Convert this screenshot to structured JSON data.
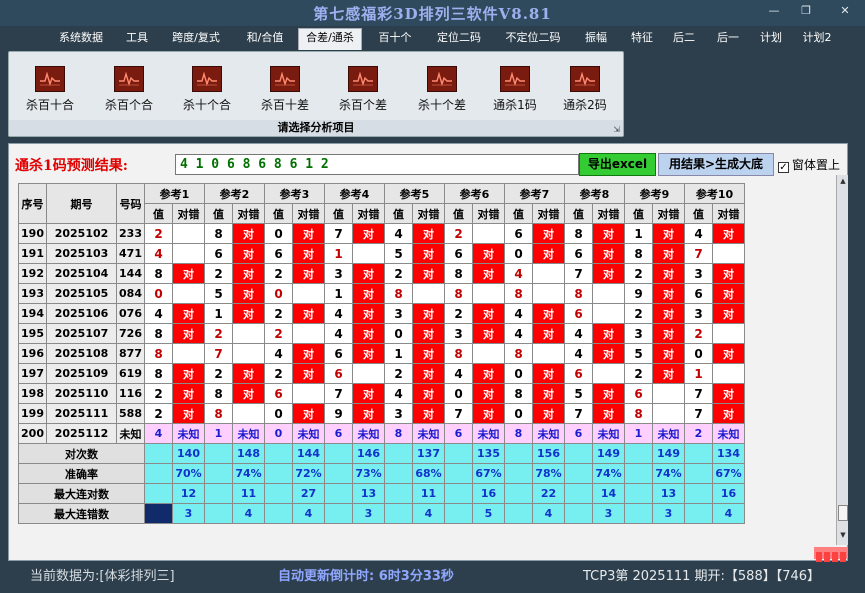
{
  "app": {
    "title": "第七感福彩3D排列三软件V8.81"
  },
  "window": {
    "minimize": "—",
    "maximize": "❐",
    "close": "✕"
  },
  "menu": [
    "系统数据",
    "工具",
    "跨度/复式",
    "和/合值",
    "合差/通杀",
    "百十个",
    "定位二码",
    "不定位二码",
    "振幅",
    "特征",
    "后二",
    "后一",
    "计划",
    "计划2"
  ],
  "menu_active": 4,
  "ribbon": {
    "buttons": [
      "杀百十合",
      "杀百个合",
      "杀十个合",
      "杀百十差",
      "杀百个差",
      "杀十个差",
      "通杀1码",
      "通杀2码"
    ],
    "caption": "请选择分析项目",
    "corner": "⇲"
  },
  "prediction": {
    "label": "通杀1码预测结果:",
    "value": "4 1 0 6 8 6 8 6 1 2",
    "export_button": "导出excel",
    "generate_button": "用结果>生成大底",
    "topmost_label": "窗体置上",
    "topmost_checked": "✓"
  },
  "table": {
    "headers": {
      "seq": "序号",
      "issue": "期号",
      "number": "号码",
      "value": "值",
      "result": "对错"
    },
    "refs": [
      "参考1",
      "参考2",
      "参考3",
      "参考4",
      "参考5",
      "参考6",
      "参考7",
      "参考8",
      "参考9",
      "参考10"
    ],
    "rows": [
      {
        "seq": "190",
        "issue": "2025102",
        "number": "233",
        "cells": [
          [
            "2",
            "",
            1
          ],
          [
            "8",
            "对",
            0
          ],
          [
            "0",
            "对",
            0
          ],
          [
            "7",
            "对",
            0
          ],
          [
            "4",
            "对",
            0
          ],
          [
            "2",
            "",
            1
          ],
          [
            "6",
            "对",
            0
          ],
          [
            "8",
            "对",
            0
          ],
          [
            "1",
            "对",
            0
          ],
          [
            "4",
            "对",
            0
          ]
        ]
      },
      {
        "seq": "191",
        "issue": "2025103",
        "number": "471",
        "cells": [
          [
            "4",
            "",
            1
          ],
          [
            "6",
            "对",
            0
          ],
          [
            "6",
            "对",
            0
          ],
          [
            "1",
            "",
            1
          ],
          [
            "5",
            "对",
            0
          ],
          [
            "6",
            "对",
            0
          ],
          [
            "0",
            "对",
            0
          ],
          [
            "6",
            "对",
            0
          ],
          [
            "8",
            "对",
            0
          ],
          [
            "7",
            "",
            1
          ]
        ]
      },
      {
        "seq": "192",
        "issue": "2025104",
        "number": "144",
        "cells": [
          [
            "8",
            "对",
            0
          ],
          [
            "2",
            "对",
            0
          ],
          [
            "2",
            "对",
            0
          ],
          [
            "3",
            "对",
            0
          ],
          [
            "2",
            "对",
            0
          ],
          [
            "8",
            "对",
            0
          ],
          [
            "4",
            "",
            1
          ],
          [
            "7",
            "对",
            0
          ],
          [
            "2",
            "对",
            0
          ],
          [
            "3",
            "对",
            0
          ]
        ]
      },
      {
        "seq": "193",
        "issue": "2025105",
        "number": "084",
        "cells": [
          [
            "0",
            "",
            1
          ],
          [
            "5",
            "对",
            0
          ],
          [
            "0",
            "",
            1
          ],
          [
            "1",
            "对",
            0
          ],
          [
            "8",
            "",
            1
          ],
          [
            "8",
            "",
            1
          ],
          [
            "8",
            "",
            1
          ],
          [
            "8",
            "",
            1
          ],
          [
            "9",
            "对",
            0
          ],
          [
            "6",
            "对",
            0
          ]
        ]
      },
      {
        "seq": "194",
        "issue": "2025106",
        "number": "076",
        "cells": [
          [
            "4",
            "对",
            0
          ],
          [
            "1",
            "对",
            0
          ],
          [
            "2",
            "对",
            0
          ],
          [
            "4",
            "对",
            0
          ],
          [
            "3",
            "对",
            0
          ],
          [
            "2",
            "对",
            0
          ],
          [
            "4",
            "对",
            0
          ],
          [
            "6",
            "",
            1
          ],
          [
            "2",
            "对",
            0
          ],
          [
            "3",
            "对",
            0
          ]
        ]
      },
      {
        "seq": "195",
        "issue": "2025107",
        "number": "726",
        "cells": [
          [
            "8",
            "对",
            0
          ],
          [
            "2",
            "",
            1
          ],
          [
            "2",
            "",
            1
          ],
          [
            "4",
            "对",
            0
          ],
          [
            "0",
            "对",
            0
          ],
          [
            "3",
            "对",
            0
          ],
          [
            "4",
            "对",
            0
          ],
          [
            "4",
            "对",
            0
          ],
          [
            "3",
            "对",
            0
          ],
          [
            "2",
            "",
            1
          ]
        ]
      },
      {
        "seq": "196",
        "issue": "2025108",
        "number": "877",
        "cells": [
          [
            "8",
            "",
            1
          ],
          [
            "7",
            "",
            1
          ],
          [
            "4",
            "对",
            0
          ],
          [
            "6",
            "对",
            0
          ],
          [
            "1",
            "对",
            0
          ],
          [
            "8",
            "",
            1
          ],
          [
            "8",
            "",
            1
          ],
          [
            "4",
            "对",
            0
          ],
          [
            "5",
            "对",
            0
          ],
          [
            "0",
            "对",
            0
          ]
        ]
      },
      {
        "seq": "197",
        "issue": "2025109",
        "number": "619",
        "cells": [
          [
            "8",
            "对",
            0
          ],
          [
            "2",
            "对",
            0
          ],
          [
            "2",
            "对",
            0
          ],
          [
            "6",
            "",
            1
          ],
          [
            "2",
            "对",
            0
          ],
          [
            "4",
            "对",
            0
          ],
          [
            "0",
            "对",
            0
          ],
          [
            "6",
            "",
            1
          ],
          [
            "2",
            "对",
            0
          ],
          [
            "1",
            "",
            1
          ]
        ]
      },
      {
        "seq": "198",
        "issue": "2025110",
        "number": "116",
        "cells": [
          [
            "2",
            "对",
            0
          ],
          [
            "8",
            "对",
            0
          ],
          [
            "6",
            "",
            1
          ],
          [
            "7",
            "对",
            0
          ],
          [
            "4",
            "对",
            0
          ],
          [
            "0",
            "对",
            0
          ],
          [
            "8",
            "对",
            0
          ],
          [
            "5",
            "对",
            0
          ],
          [
            "6",
            "",
            1
          ],
          [
            "7",
            "对",
            0
          ]
        ]
      },
      {
        "seq": "199",
        "issue": "2025111",
        "number": "588",
        "cells": [
          [
            "2",
            "对",
            0
          ],
          [
            "8",
            "",
            1
          ],
          [
            "0",
            "对",
            0
          ],
          [
            "9",
            "对",
            0
          ],
          [
            "3",
            "对",
            0
          ],
          [
            "7",
            "对",
            0
          ],
          [
            "0",
            "对",
            0
          ],
          [
            "7",
            "对",
            0
          ],
          [
            "8",
            "",
            1
          ],
          [
            "7",
            "对",
            0
          ]
        ]
      }
    ],
    "predict_row": {
      "seq": "200",
      "issue": "2025112",
      "number": "未知",
      "values": [
        "4",
        "1",
        "0",
        "6",
        "8",
        "6",
        "8",
        "6",
        "1",
        "2"
      ],
      "result": "未知"
    },
    "stats": [
      {
        "label": "对次数",
        "values": [
          "140",
          "148",
          "144",
          "146",
          "137",
          "135",
          "156",
          "149",
          "149",
          "134"
        ]
      },
      {
        "label": "准确率",
        "values": [
          "70%",
          "74%",
          "72%",
          "73%",
          "68%",
          "67%",
          "78%",
          "74%",
          "74%",
          "67%"
        ]
      },
      {
        "label": "最大连对数",
        "values": [
          "12",
          "11",
          "27",
          "13",
          "11",
          "16",
          "22",
          "14",
          "13",
          "16"
        ]
      },
      {
        "label": "最大连错数",
        "values": [
          "3",
          "4",
          "4",
          "3",
          "4",
          "5",
          "4",
          "3",
          "3",
          "4"
        ]
      }
    ]
  },
  "status": {
    "source": "当前数据为:[体彩排列三]",
    "refresh": "自动更新倒计时:  6时3分33秒",
    "draw": "TCP3第 2025111 期开:【588】【746】"
  },
  "colors": {
    "hit": "#ff0000",
    "stats": "#77eef0",
    "predict": "#ffd0ff",
    "accent_red": "#c00000"
  }
}
